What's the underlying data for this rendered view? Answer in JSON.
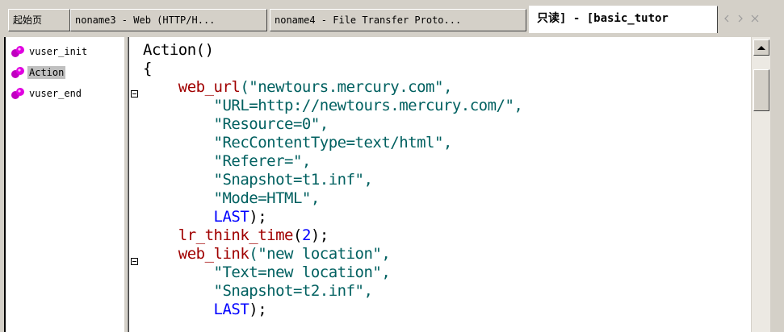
{
  "tabs": [
    {
      "label": "起始页",
      "active": false
    },
    {
      "label": "noname3 - Web (HTTP/H...",
      "active": false
    },
    {
      "label": "noname4 - File Transfer Proto...",
      "active": false
    },
    {
      "label": "只读] - [basic_tutor",
      "active": true
    }
  ],
  "tab_nav": {
    "prev_icon": "triangle-left",
    "next_icon": "triangle-right",
    "close_icon": "close-x"
  },
  "tree": {
    "items": [
      {
        "label": "vuser_init",
        "selected": false,
        "icon": "script-ball-icon"
      },
      {
        "label": "Action",
        "selected": true,
        "icon": "script-ball-icon"
      },
      {
        "label": "vuser_end",
        "selected": false,
        "icon": "script-ball-icon"
      }
    ]
  },
  "code": {
    "lines": [
      [
        {
          "t": "Action()",
          "c": ""
        }
      ],
      [
        {
          "t": "{",
          "c": ""
        }
      ],
      [
        {
          "t": "    ",
          "c": ""
        },
        {
          "t": "web_url",
          "c": "fn"
        },
        {
          "t": "(\"newtours.mercury.com\",",
          "c": "str"
        }
      ],
      [
        {
          "t": "        \"URL=http://newtours.mercury.com/\",",
          "c": "str"
        }
      ],
      [
        {
          "t": "        \"Resource=0\",",
          "c": "str"
        }
      ],
      [
        {
          "t": "        \"RecContentType=text/html\",",
          "c": "str"
        }
      ],
      [
        {
          "t": "        \"Referer=\",",
          "c": "str"
        }
      ],
      [
        {
          "t": "        \"Snapshot=t1.inf\",",
          "c": "str"
        }
      ],
      [
        {
          "t": "        \"Mode=HTML\",",
          "c": "str"
        }
      ],
      [
        {
          "t": "        ",
          "c": ""
        },
        {
          "t": "LAST",
          "c": "kw"
        },
        {
          "t": ");",
          "c": ""
        }
      ],
      [
        {
          "t": "    ",
          "c": ""
        },
        {
          "t": "lr_think_time",
          "c": "fn"
        },
        {
          "t": "(",
          "c": ""
        },
        {
          "t": "2",
          "c": "num"
        },
        {
          "t": ");",
          "c": ""
        }
      ],
      [
        {
          "t": "    ",
          "c": ""
        },
        {
          "t": "web_link",
          "c": "fn"
        },
        {
          "t": "(\"new location\",",
          "c": "str"
        }
      ],
      [
        {
          "t": "        \"Text=new location\",",
          "c": "str"
        }
      ],
      [
        {
          "t": "        \"Snapshot=t2.inf\",",
          "c": "str"
        }
      ],
      [
        {
          "t": "        ",
          "c": ""
        },
        {
          "t": "LAST",
          "c": "kw"
        },
        {
          "t": ");",
          "c": ""
        }
      ]
    ]
  }
}
